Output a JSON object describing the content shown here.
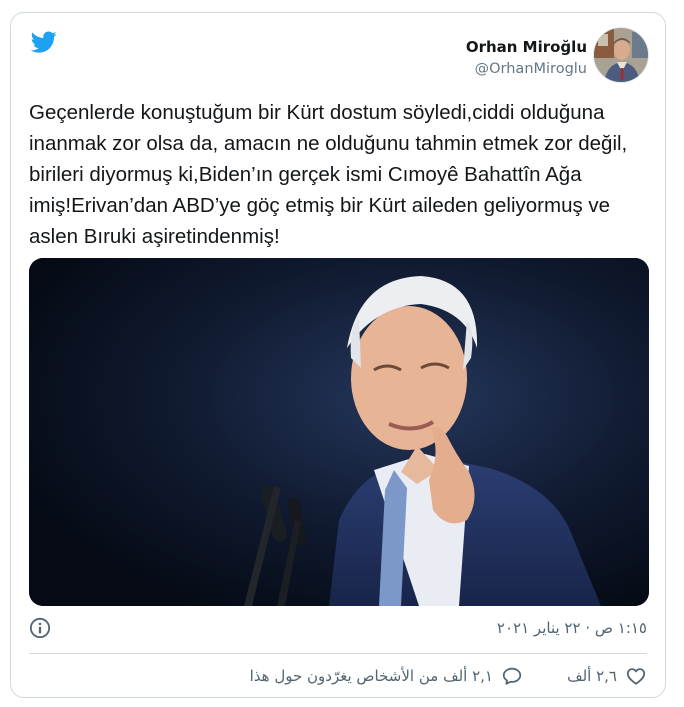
{
  "author": {
    "name": "Orhan Miroğlu",
    "handle": "@OrhanMiroglu"
  },
  "tweet": {
    "text": "Geçenlerde konuştuğum bir Kürt dostum söyledi,ciddi olduğuna inanmak zor olsa da, amacın ne olduğunu tahmin etmek zor değil, birileri diyormuş ki,Biden’ın gerçek ismi Cımoyê Bahattîn Ağa imiş!Erivan’dan ABD’ye göç etmiş bir Kürt aileden geliyormuş ve aslen Bıruki aşiretindenmiş!",
    "timestamp": "١:١٥ ص · ٢٢ يناير ٢٠٢١"
  },
  "actions": {
    "like_count": "٢,٦ ألف",
    "reply_text": "٢,١ ألف من الأشخاص يغرّدون حول هذا"
  },
  "icons": {
    "brand": "twitter-bird-icon",
    "info": "info-icon",
    "like": "heart-icon",
    "reply": "reply-bubble-icon"
  },
  "colors": {
    "brand_blue": "#1da1f2",
    "text_primary": "#14171a",
    "text_secondary": "#536471",
    "border": "#cfd9de"
  }
}
